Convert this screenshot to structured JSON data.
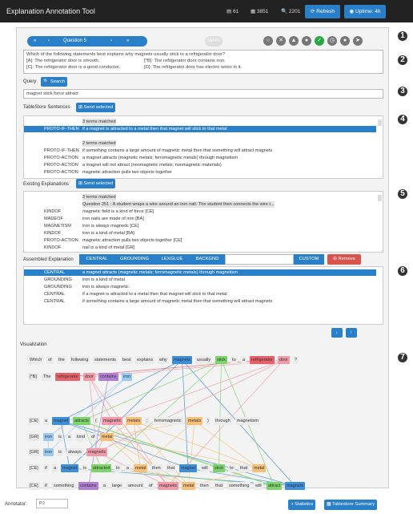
{
  "app": {
    "title": "Explanation Annotation Tool",
    "stat1": "61",
    "stat2": "3851",
    "stat3": "2201",
    "refresh": "Refresh",
    "uptime": "Uptime: 4h"
  },
  "qnav": {
    "first": "«",
    "prev": "‹",
    "label": "Question 5",
    "next": "›",
    "last": "»",
    "annotator_badge": "SM PJ"
  },
  "question": {
    "line1": "Which of the following statements best explains why magnets usually stick to a refrigerator door?",
    "line2a": "[A]: The refrigerator door is smooth.",
    "line2b": "[*B]: The refrigerator door contains iron.",
    "line3a": "[C]: The refrigerator door is a good conductor.",
    "line3b": "[D]: The refrigerator door has electric wires in it."
  },
  "query": {
    "label": "Query",
    "search": "Search",
    "value": "magnet stick force attract"
  },
  "tablestore": {
    "label": "TableStore Sentences",
    "send": "Send selected",
    "rows": [
      {
        "c1": "",
        "c2": "3 terms matched",
        "hl": true
      },
      {
        "c1": "PROTO-IF-THEN",
        "c2": "if a magnet is attracted to a metal then that magnet will stick to that metal",
        "sel": true
      },
      {
        "c1": "",
        "c2": ""
      },
      {
        "c1": "",
        "c2": "2 terms matched",
        "hl": true
      },
      {
        "c1": "PROTO-IF-THEN",
        "c2": "if something contains a large amount of magnetic metal then that something will attract magnets"
      },
      {
        "c1": "PROTO-ACTION",
        "c2": "a magnet attracts (magnetic metals; ferromagnetic metals) through magnetism"
      },
      {
        "c1": "PROTO-ACTION",
        "c2": "a magnet will not attract (nonmagnetic metals; nonmagnetic materials)"
      },
      {
        "c1": "PROTO-ACTION",
        "c2": "magnetic attraction pulls two objects together"
      }
    ]
  },
  "existing": {
    "label": "Existing Explanations",
    "send": "Send selected",
    "rows": [
      {
        "c1": "",
        "c2": "3 terms matched",
        "hl": true
      },
      {
        "c1": "",
        "c2": "Question 251 : A student wraps a wire around an iron nail. The student then connects the wire t...",
        "hl": true
      },
      {
        "c1": "KINDOF",
        "c2": "magnetic field is a kind of force [CE]"
      },
      {
        "c1": "MADEOF",
        "c2": "iron nails are made of iron [BA]"
      },
      {
        "c1": "MAGNETISM",
        "c2": "iron is always magnetic [CE]"
      },
      {
        "c1": "KINDOF",
        "c2": "iron is a kind of metal [BA]"
      },
      {
        "c1": "PROTO-ACTION",
        "c2": "magnetic attraction pulls two objects together [CE]"
      },
      {
        "c1": "KINDOF",
        "c2": "nail is a kind of metal [GR]"
      }
    ]
  },
  "assembled": {
    "label": "Assembled Explanation",
    "roles": [
      "CENTRAL",
      "GROUNDING",
      "LEXGLUE",
      "BACKGND"
    ],
    "custom": "CUSTOM",
    "remove": "Remove",
    "rows": [
      {
        "c1": "CENTRAL",
        "c2": "a magnet attracts (magnetic metals; ferromagnetic metals) through magnetism",
        "sel": true
      },
      {
        "c1": "GROUNDING",
        "c2": "iron is a kind of metal"
      },
      {
        "c1": "GROUNDING",
        "c2": "iron is always magnetic"
      },
      {
        "c1": "CENTRAL",
        "c2": "if a magnet is attracted to a metal then that magnet will stick to that metal"
      },
      {
        "c1": "CENTRAL",
        "c2": "if something contains a large amount of magnetic metal then that something will attract magnets"
      }
    ]
  },
  "viz": {
    "label": "Visualization",
    "rows": [
      {
        "tokens": [
          "Which",
          "of",
          "the",
          "following",
          "statements",
          "best",
          "explains",
          "why",
          "magnets",
          "usually",
          "stick",
          "to",
          "a",
          "refrigerator",
          "door",
          "?"
        ],
        "colors": [
          "",
          "",
          "",
          "",
          "",
          "",
          "",
          "",
          "blue",
          "",
          "green",
          "",
          "",
          "red",
          "pink",
          ""
        ]
      },
      {
        "tokens": [
          "[*B]",
          "The",
          "refrigerator",
          "door",
          "contains",
          "iron"
        ],
        "colors": [
          "",
          "",
          "red",
          "pink",
          "purple",
          "lblue"
        ]
      },
      {
        "tokens": [
          "[CE]",
          "a",
          "magnet",
          "attracts",
          "(",
          "magnetic",
          "metals",
          ";",
          "ferromagnetic",
          "metals",
          ")",
          "through",
          "magnetism"
        ],
        "colors": [
          "",
          "",
          "blue",
          "green",
          "",
          "pink",
          "orange",
          "",
          "",
          "orange",
          "",
          "",
          ""
        ]
      },
      {
        "tokens": [
          "[GR]",
          "iron",
          "is",
          "a",
          "kind",
          "of",
          "metal"
        ],
        "colors": [
          "",
          "lblue",
          "",
          "",
          "",
          "",
          "orange"
        ]
      },
      {
        "tokens": [
          "[GR]",
          "iron",
          "is",
          "always",
          "magnetic"
        ],
        "colors": [
          "",
          "lblue",
          "",
          "",
          "pink"
        ]
      },
      {
        "tokens": [
          "[CE]",
          "if",
          "a",
          "magnet",
          "is",
          "attracted",
          "to",
          "a",
          "metal",
          "then",
          "that",
          "magnet",
          "will",
          "stick",
          "to",
          "that",
          "metal"
        ],
        "colors": [
          "",
          "",
          "",
          "blue",
          "",
          "green",
          "",
          "",
          "orange",
          "",
          "",
          "blue",
          "",
          "green",
          "",
          "",
          "orange"
        ]
      },
      {
        "tokens": [
          "[CE]",
          "if",
          "something",
          "contains",
          "a",
          "large",
          "amount",
          "of",
          "magnetic",
          "metal",
          "then",
          "that",
          "something",
          "will",
          "attract",
          "magnets"
        ],
        "colors": [
          "",
          "",
          "",
          "purple",
          "",
          "",
          "",
          "",
          "pink",
          "orange",
          "",
          "",
          "",
          "",
          "green",
          "blue"
        ]
      }
    ]
  },
  "footer": {
    "annotator_label": "Annotator:",
    "annotator_value": "PJ",
    "statistics": "Statistics",
    "summary": "Tablestore Summary"
  },
  "steps": [
    "1",
    "2",
    "3",
    "4",
    "5",
    "6",
    "7"
  ],
  "palette": {
    "blue": "#3d8fd9",
    "green": "#7dd46b",
    "red": "#e8606a",
    "pink": "#f29aa8",
    "purple": "#b07ed6",
    "lblue": "#9cc9ef",
    "orange": "#f6c07a"
  }
}
